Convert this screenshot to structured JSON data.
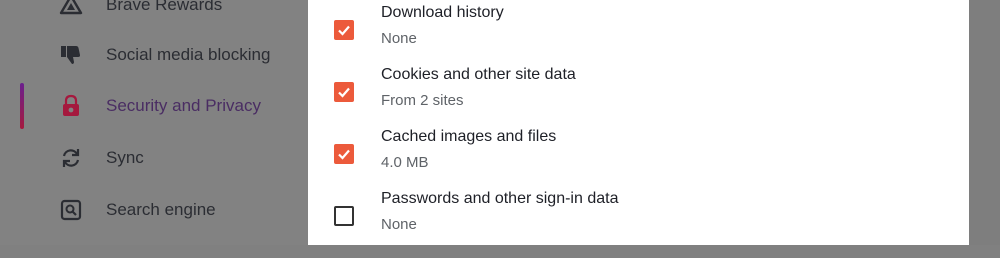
{
  "sidebar": {
    "items": [
      {
        "label": "Brave Rewards",
        "icon": "brave-rewards-triangle-icon",
        "active": false
      },
      {
        "label": "Social media blocking",
        "icon": "thumbs-down-icon",
        "active": false
      },
      {
        "label": "Security and Privacy",
        "icon": "lock-icon",
        "active": true
      },
      {
        "label": "Sync",
        "icon": "sync-arrows-icon",
        "active": false
      },
      {
        "label": "Search engine",
        "icon": "search-engine-icon",
        "active": false
      }
    ],
    "active_accent": "#a5193e"
  },
  "dialog": {
    "options": [
      {
        "title": "Download history",
        "detail": "None",
        "checked": true
      },
      {
        "title": "Cookies and other site data",
        "detail": "From 2 sites",
        "checked": true
      },
      {
        "title": "Cached images and files",
        "detail": "4.0 MB",
        "checked": true
      },
      {
        "title": "Passwords and other sign-in data",
        "detail": "None",
        "checked": false
      }
    ],
    "checkbox_color": "#ec5a3b"
  }
}
